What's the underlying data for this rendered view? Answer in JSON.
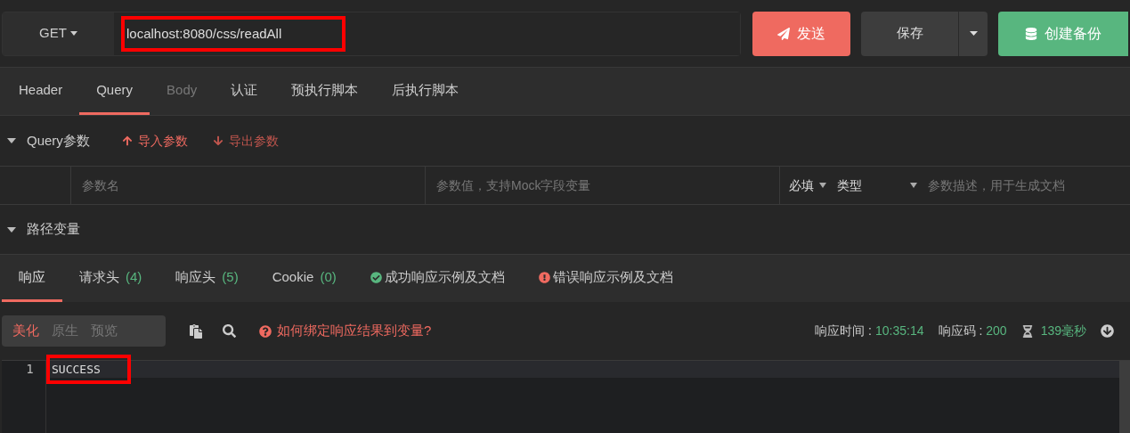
{
  "request": {
    "method": "GET",
    "url": "localhost:8080/css/readAll",
    "url_highlighted": true,
    "send": "发送",
    "save": "保存",
    "backup": "创建备份"
  },
  "request_tabs": [
    {
      "label": "Header",
      "selected": false,
      "disabled": false
    },
    {
      "label": "Query",
      "selected": true,
      "disabled": false
    },
    {
      "label": "Body",
      "selected": false,
      "disabled": true
    },
    {
      "label": "认证",
      "selected": false,
      "disabled": false
    },
    {
      "label": "预执行脚本",
      "selected": false,
      "disabled": false
    },
    {
      "label": "后执行脚本",
      "selected": false,
      "disabled": false
    }
  ],
  "query_section": {
    "title": "Query参数",
    "expanded": true,
    "import": "导入参数",
    "export": "导出参数"
  },
  "param_row": {
    "name_placeholder": "参数名",
    "value_placeholder": "参数值，支持Mock字段变量",
    "required": "必填",
    "type": "类型",
    "description_placeholder": "参数描述，用于生成文档"
  },
  "path_section": {
    "title": "路径变量",
    "expanded": true
  },
  "response_tabs": [
    {
      "kind": "plain",
      "label": "响应",
      "selected": true
    },
    {
      "kind": "count",
      "label": "请求头",
      "count": "(4)",
      "selected": false
    },
    {
      "kind": "count",
      "label": "响应头",
      "count": "(5)",
      "selected": false
    },
    {
      "kind": "count",
      "label": "Cookie",
      "count": "(0)",
      "selected": false
    },
    {
      "kind": "success",
      "label": "成功响应示例及文档",
      "selected": false
    },
    {
      "kind": "error",
      "label": "错误响应示例及文档",
      "selected": false
    }
  ],
  "view_modes": [
    {
      "label": "美化",
      "selected": true
    },
    {
      "label": "原生",
      "selected": false
    },
    {
      "label": "预览",
      "selected": false
    }
  ],
  "help_link": "如何绑定响应结果到变量?",
  "stats": {
    "time_label": "响应时间 :",
    "time": "10:35:14",
    "code_label": "响应码 :",
    "code": "200",
    "duration": "139毫秒"
  },
  "editor": {
    "lines": [
      {
        "number": "1",
        "text": "SUCCESS",
        "highlighted": true
      }
    ]
  }
}
